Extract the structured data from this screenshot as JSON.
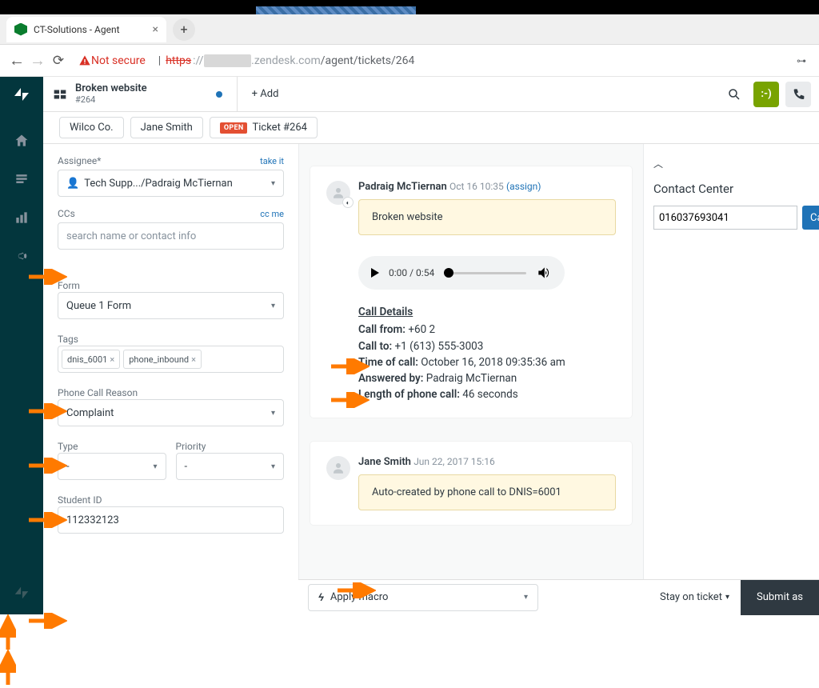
{
  "browser": {
    "tab_title": "CT-Solutions - Agent",
    "not_secure": "Not secure",
    "url_https": "https",
    "url_colon": "://",
    "url_domain": ".zendesk.com",
    "url_path": "/agent/tickets/264",
    "key_icon": "⊶"
  },
  "topbar": {
    "title": "Broken website",
    "ticket": "#264",
    "add": "+ Add",
    "smile": ":-)"
  },
  "crumbs": {
    "company": "Wilco Co.",
    "user": "Jane Smith",
    "open_badge": "OPEN",
    "ticket": "Ticket #264"
  },
  "sidebar": {
    "assignee_label": "Assignee*",
    "take_it": "take it",
    "assignee_value": "Tech Supp.../Padraig McTiernan",
    "ccs_label": "CCs",
    "cc_me": "cc me",
    "ccs_placeholder": "search name or contact info",
    "form_label": "Form",
    "form_value": "Queue 1 Form",
    "tags_label": "Tags",
    "tags": [
      "dnis_6001",
      "phone_inbound"
    ],
    "reason_label": "Phone Call Reason",
    "reason_value": "Complaint",
    "type_label": "Type",
    "type_value": "-",
    "priority_label": "Priority",
    "priority_value": "-",
    "student_label": "Student ID",
    "student_value": "112332123"
  },
  "convo": {
    "msg1": {
      "name": "Padraig McTiernan",
      "time": "Oct 16 10:35",
      "assign": "(assign)",
      "note": "Broken website",
      "audio_time": "0:00 / 0:54"
    },
    "call": {
      "title": "Call Details",
      "from_l": "Call from:",
      "from_v": " +60 2",
      "to_l": "Call to:",
      "to_v": " +1 (613) 555-3003",
      "time_l": "Time of call:",
      "time_v": " October 16, 2018 09:35:36 am",
      "ans_l": "Answered by:",
      "ans_v": " Padraig McTiernan",
      "len_l": "Length of phone call:",
      "len_v": " 46 seconds"
    },
    "msg2": {
      "name": "Jane Smith",
      "time": "Jun 22, 2017 15:16",
      "note": "Auto-created by phone call to DNIS=6001"
    }
  },
  "right": {
    "title": "Contact Center",
    "number": "016037693041",
    "call": "Call"
  },
  "footer": {
    "macro": "Apply macro",
    "stay": "Stay on ticket",
    "submit": "Submit as"
  }
}
